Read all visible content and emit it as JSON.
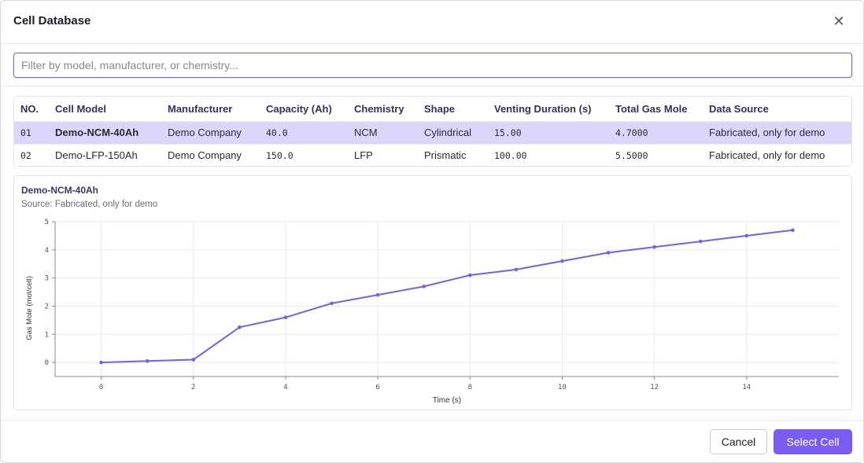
{
  "dialog": {
    "title": "Cell Database",
    "close_glyph": "✕"
  },
  "filter": {
    "placeholder": "Filter by model, manufacturer, or chemistry...",
    "value": ""
  },
  "table": {
    "headers": [
      "NO.",
      "Cell Model",
      "Manufacturer",
      "Capacity (Ah)",
      "Chemistry",
      "Shape",
      "Venting Duration (s)",
      "Total Gas Mole",
      "Data Source"
    ],
    "rows": [
      [
        "01",
        "Demo-NCM-40Ah",
        "Demo Company",
        "40.0",
        "NCM",
        "Cylindrical",
        "15.00",
        "4.7000",
        "Fabricated, only for demo"
      ],
      [
        "02",
        "Demo-LFP-150Ah",
        "Demo Company",
        "150.0",
        "LFP",
        "Prismatic",
        "100.00",
        "5.5000",
        "Fabricated, only for demo"
      ]
    ],
    "selected_index": 0
  },
  "chart": {
    "title": "Demo-NCM-40Ah",
    "source": "Source: Fabricated, only for demo"
  },
  "chart_data": {
    "type": "line",
    "x": [
      0,
      1,
      2,
      3,
      4,
      5,
      6,
      7,
      8,
      9,
      10,
      11,
      12,
      13,
      14,
      15
    ],
    "series": [
      {
        "values": [
          0,
          0.05,
          0.1,
          1.25,
          1.6,
          2.1,
          2.4,
          2.7,
          3.1,
          3.3,
          3.6,
          3.9,
          4.1,
          4.3,
          4.5,
          4.7
        ]
      }
    ],
    "xlabel": "Time (s)",
    "ylabel": "Gas Mole (mol/cell)",
    "xticks": [
      0,
      2,
      4,
      6,
      8,
      10,
      12,
      14
    ],
    "yticks": [
      0,
      1,
      2,
      3,
      4,
      5
    ],
    "xlim": [
      -1,
      16
    ],
    "ylim": [
      -0.5,
      5
    ],
    "grid": true,
    "line_color": "#7b5cf0"
  },
  "footer": {
    "cancel_label": "Cancel",
    "select_label": "Select Cell"
  }
}
